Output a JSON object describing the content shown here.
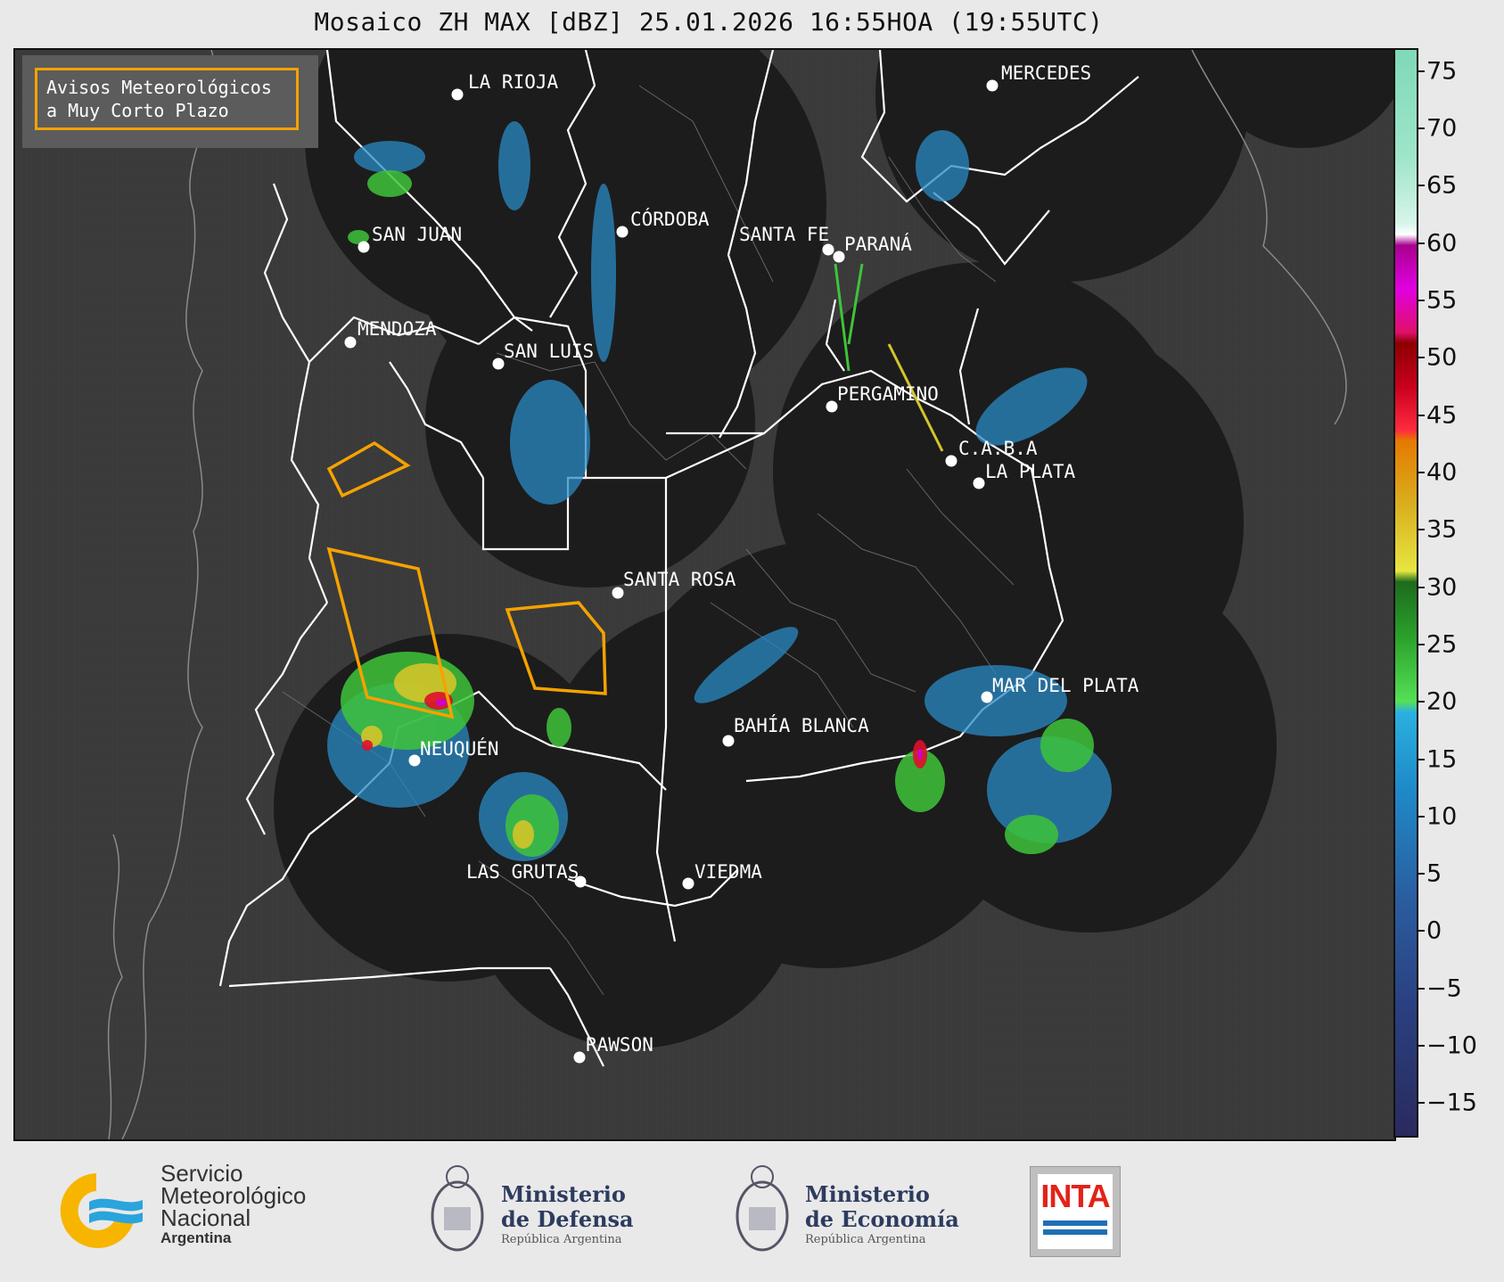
{
  "title": "Mosaico ZH MAX [dBZ] 25.01.2026 16:55HOA (19:55UTC)",
  "legend": {
    "line1": "Avisos Meteorológicos",
    "line2": "a Muy Corto Plazo",
    "outline_color": "#f5a200"
  },
  "cities": [
    {
      "id": "la-rioja",
      "name": "LA RIOJA"
    },
    {
      "id": "mercedes",
      "name": "MERCEDES"
    },
    {
      "id": "cordoba",
      "name": "CÓRDOBA"
    },
    {
      "id": "san-juan",
      "name": "SAN JUAN"
    },
    {
      "id": "santa-fe",
      "name": "SANTA FE"
    },
    {
      "id": "parana",
      "name": "PARANÁ"
    },
    {
      "id": "mendoza",
      "name": "MENDOZA"
    },
    {
      "id": "san-luis",
      "name": "SAN LUIS"
    },
    {
      "id": "pergamino",
      "name": "PERGAMINO"
    },
    {
      "id": "caba",
      "name": "C.A.B.A"
    },
    {
      "id": "la-plata",
      "name": "LA PLATA"
    },
    {
      "id": "santa-rosa",
      "name": "SANTA ROSA"
    },
    {
      "id": "mar-del-plata",
      "name": "MAR DEL PLATA"
    },
    {
      "id": "bahia-blanca",
      "name": "BAHÍA BLANCA"
    },
    {
      "id": "neuquen",
      "name": "NEUQUÉN"
    },
    {
      "id": "las-grutas",
      "name": "LAS GRUTAS"
    },
    {
      "id": "viedma",
      "name": "VIEDMA"
    },
    {
      "id": "rawson",
      "name": "RAWSON"
    }
  ],
  "colorbar": {
    "unit": "dBZ",
    "min": -18,
    "max": 77,
    "ticks": [
      "75",
      "70",
      "65",
      "60",
      "55",
      "50",
      "45",
      "40",
      "35",
      "30",
      "25",
      "20",
      "15",
      "10",
      "5",
      "0",
      "−5",
      "−10",
      "−15"
    ],
    "tick_values": [
      75,
      70,
      65,
      60,
      55,
      50,
      45,
      40,
      35,
      30,
      25,
      20,
      15,
      10,
      5,
      0,
      -5,
      -10,
      -15
    ]
  },
  "footer": {
    "smn": {
      "line1": "Servicio",
      "line2": "Meteorológico",
      "line3": "Nacional",
      "line4": "Argentina"
    },
    "defensa": {
      "line1": "Ministerio",
      "line2": "de Defensa",
      "line3": "República Argentina"
    },
    "economia": {
      "line1": "Ministerio",
      "line2": "de Economía",
      "line3": "República Argentina"
    },
    "inta": "INTA"
  },
  "colors": {
    "radar_coverage": "#1c1c1c",
    "background_map": "#3a3a3a",
    "warning": "#f5a200"
  }
}
